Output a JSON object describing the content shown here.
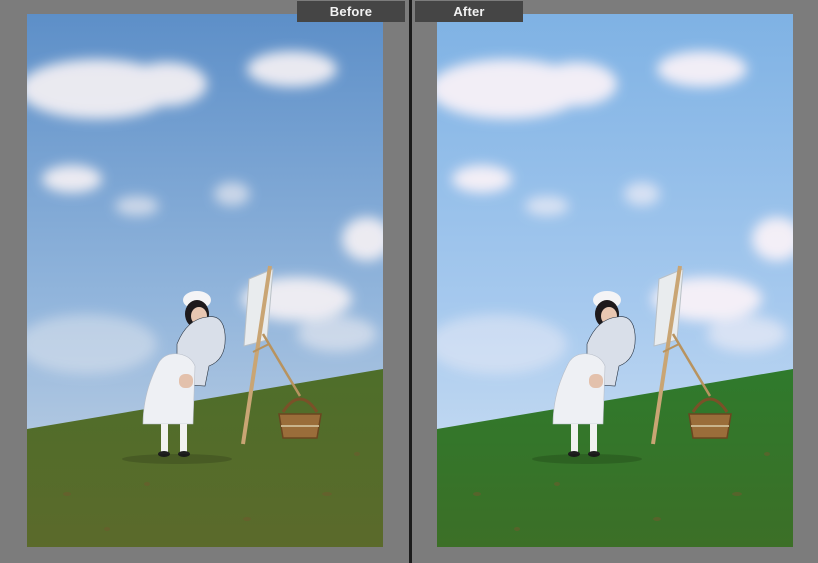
{
  "compare_view": {
    "before_label": "Before",
    "after_label": "After"
  },
  "colors": {
    "workspace_bg": "#7c7c7c",
    "divider": "#1b1b1b",
    "label_bg": "#454545",
    "label_text": "#f2f2f2"
  },
  "photos": {
    "before": {
      "sky_top": "#5d8fc8",
      "sky_mid": "#93b6dc",
      "sky_bottom": "#c9d6e6",
      "grass_top": "#4e6e2a",
      "grass_bottom": "#5b6a2b",
      "cloud": "#f5f1f4",
      "figure_shadow": "#2a3440"
    },
    "after": {
      "sky_top": "#7fb2e4",
      "sky_mid": "#a6c9ee",
      "sky_bottom": "#d6e4f4",
      "grass_top": "#2f7a2c",
      "grass_bottom": "#3c6f27",
      "cloud": "#fbf3f8",
      "figure_shadow": "#243040"
    }
  },
  "icons": [
    "easel-icon",
    "basket-icon"
  ]
}
